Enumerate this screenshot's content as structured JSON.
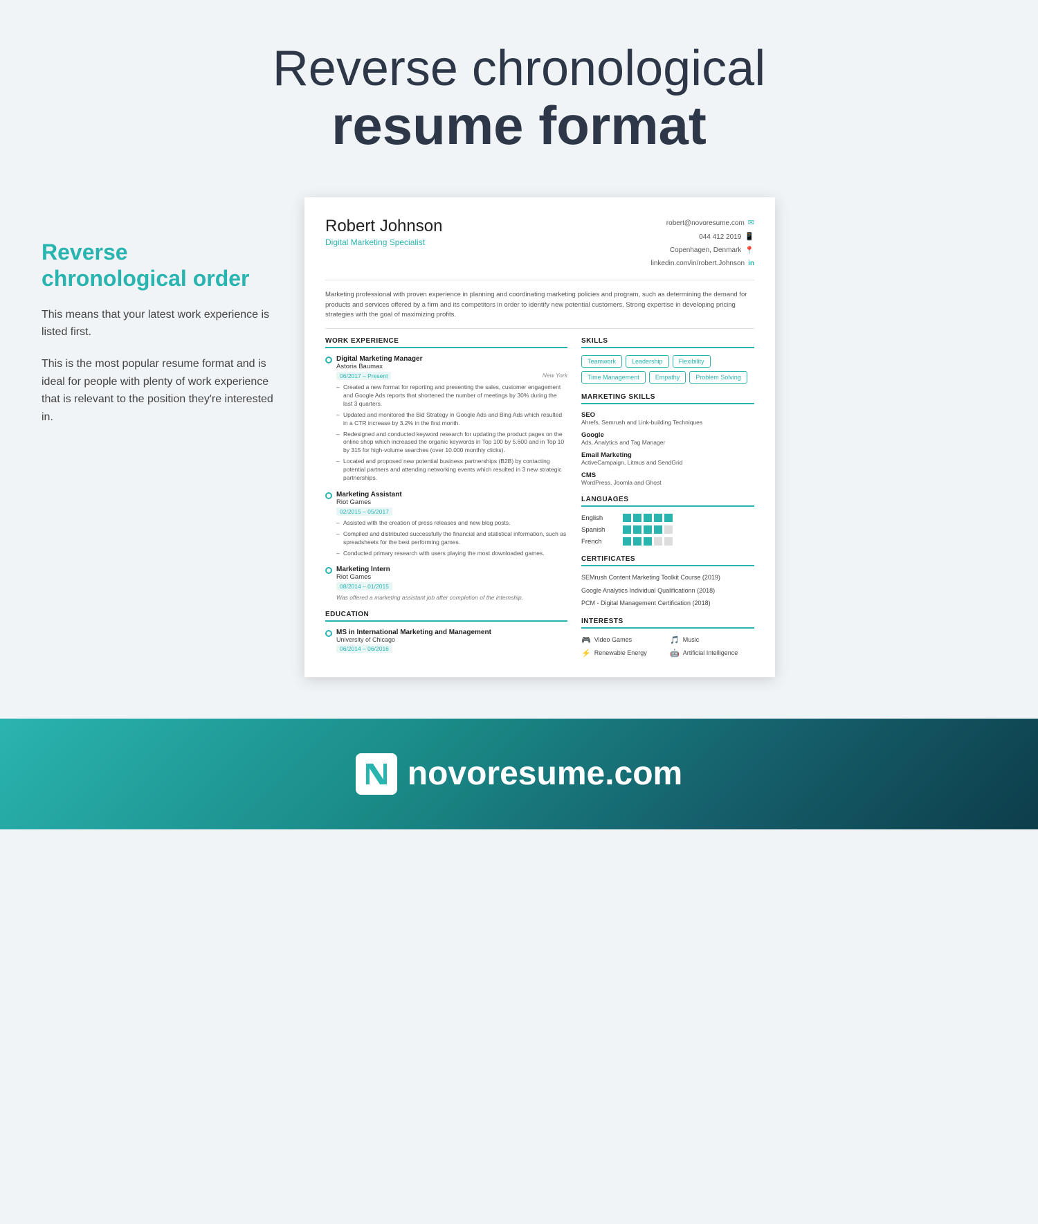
{
  "page": {
    "header": {
      "line1": "Reverse chronological",
      "line2": "resume format"
    },
    "left_col": {
      "title": "Reverse chronological order",
      "text1": "This means that your latest work experience is listed first.",
      "text2": "This is the most popular resume format and is ideal for people with plenty of work experience that is relevant to the position they're interested in."
    },
    "resume": {
      "name": "Robert Johnson",
      "title": "Digital Marketing Specialist",
      "contact": {
        "email": "robert@novoresume.com",
        "phone": "044 412 2019",
        "location": "Copenhagen, Denmark",
        "linkedin": "linkedin.com/in/robert.Johnson"
      },
      "summary": "Marketing professional with proven experience in planning and coordinating marketing policies and program, such as determining the demand for products and services offered by a firm and its competitors in order to identify new potential customers. Strong expertise in developing pricing strategies with the goal of maximizing profits.",
      "work_experience": {
        "label": "WORK EXPERIENCE",
        "jobs": [
          {
            "title": "Digital Marketing Manager",
            "company": "Astoria Baumax",
            "dates": "06/2017 – Present",
            "location": "New York",
            "bullets": [
              "Created a new format for reporting and presenting the sales, customer engagement and Google Ads reports that shortened the number of meetings by 30% during the last 3 quarters.",
              "Updated and monitored the Bid Strategy in Google Ads and Bing Ads which resulted in a CTR increase by 3.2% in the first month.",
              "Redesigned and conducted keyword research for updating the product pages on the online shop which increased the organic keywords in Top 100 by 5.600 and in Top 10 by 315 for high-volume searches (over 10.000 monthly clicks).",
              "Located and proposed new potential business partnerships (B2B) by contacting potential partners and attending networking events which resulted in 3 new strategic partnerships."
            ]
          },
          {
            "title": "Marketing Assistant",
            "company": "Riot Games",
            "dates": "02/2015 – 05/2017",
            "location": "",
            "bullets": [
              "Assisted with the creation of press releases and new blog posts.",
              "Compiled and distributed successfully the financial and statistical information, such as spreadsheets for the best performing games.",
              "Conducted primary research with users playing the most downloaded games."
            ]
          },
          {
            "title": "Marketing Intern",
            "company": "Riot Games",
            "dates": "08/2014 – 01/2015",
            "location": "",
            "bullets": [],
            "italic": "Was offered a marketing assistant job after completion of the internship."
          }
        ]
      },
      "education": {
        "label": "EDUCATION",
        "entries": [
          {
            "degree": "MS in International Marketing and Management",
            "school": "University of Chicago",
            "dates": "06/2014 – 06/2016"
          }
        ]
      },
      "skills": {
        "label": "SKILLS",
        "tags": [
          "Teamwork",
          "Leadership",
          "Flexibility",
          "Time Management",
          "Empathy",
          "Problem Solving"
        ]
      },
      "marketing_skills": {
        "label": "MARKETING SKILLS",
        "items": [
          {
            "name": "SEO",
            "desc": "Ahrefs, Semrush and Link-building Techniques"
          },
          {
            "name": "Google",
            "desc": "Ads, Analytics and Tag Manager"
          },
          {
            "name": "Email Marketing",
            "desc": "ActiveCampaign, Litmus and SendGrid"
          },
          {
            "name": "CMS",
            "desc": "WordPress, Joomla and Ghost"
          }
        ]
      },
      "languages": {
        "label": "LANGUAGES",
        "entries": [
          {
            "name": "English",
            "level": 5
          },
          {
            "name": "Spanish",
            "level": 4
          },
          {
            "name": "French",
            "level": 3
          }
        ]
      },
      "certificates": {
        "label": "CERTIFICATES",
        "entries": [
          "SEMrush Content Marketing Toolkit Course (2019)",
          "Google Analytics Individual Qualificationn (2018)",
          "PCM - Digital Management Certification (2018)"
        ]
      },
      "interests": {
        "label": "INTERESTS",
        "entries": [
          {
            "icon": "🎮",
            "label": "Video Games"
          },
          {
            "icon": "🎵",
            "label": "Music"
          },
          {
            "icon": "⚡",
            "label": "Renewable Energy"
          },
          {
            "icon": "🤖",
            "label": "Artificial Intelligence"
          }
        ]
      }
    },
    "footer": {
      "domain": "novoresume.com"
    }
  }
}
